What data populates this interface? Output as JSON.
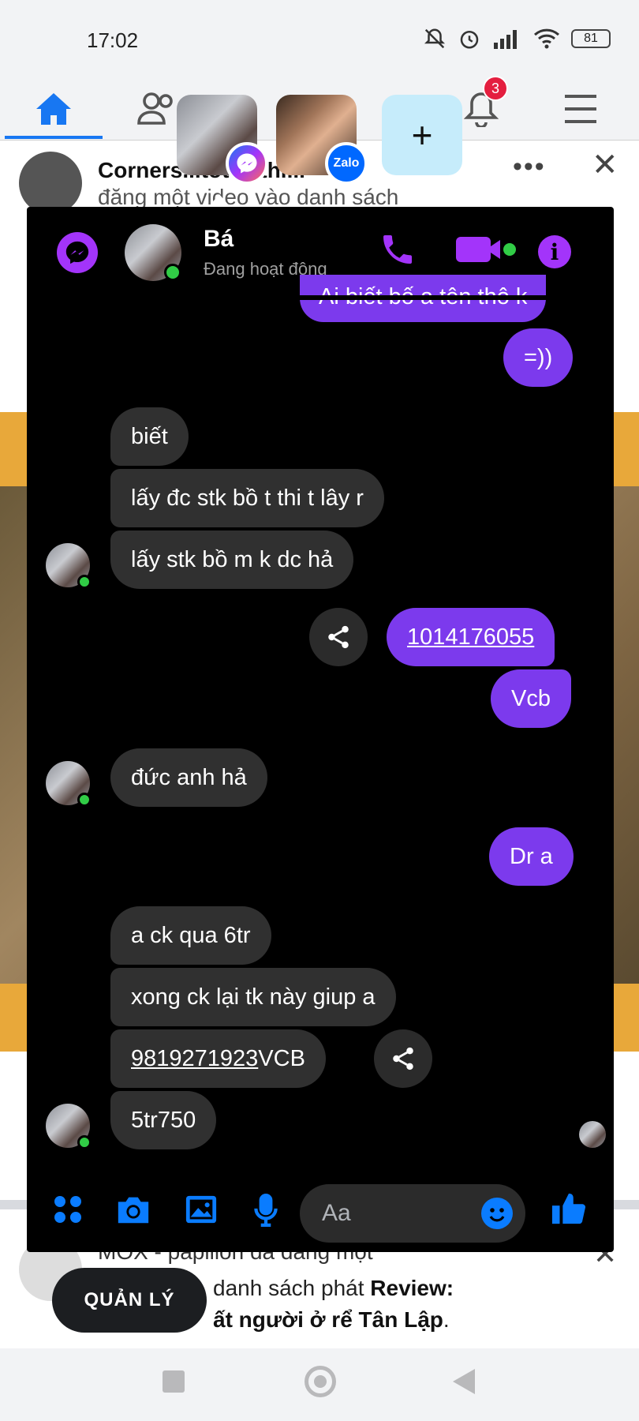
{
  "status_bar": {
    "time": "17:02",
    "battery": "81"
  },
  "fb_nav": {
    "notifications_count": "3"
  },
  "feed": {
    "post1": {
      "author": "Corners...tota...thi...",
      "subtitle": "đăng một video vào danh sách"
    },
    "post2": {
      "author": "MOX - papillon đã đăng một",
      "line1": "danh sách phát ",
      "line1_bold": "Review:",
      "line2_bold": "ất người ở rể Tân Lập",
      "line2_end": "."
    },
    "manage_button": "QUẢN LÝ"
  },
  "chat_heads": {
    "add_label": "+",
    "zalo_label": "Zalo"
  },
  "messenger": {
    "contact_name": "Bá",
    "contact_status": "Đang hoạt động",
    "messages": [
      {
        "side": "out",
        "text": "Ai biết bố a tên thô k"
      },
      {
        "side": "out",
        "text": "=))"
      },
      {
        "side": "in",
        "text": "biết"
      },
      {
        "side": "in",
        "text": "lấy đc stk bồ t thi t lây r"
      },
      {
        "side": "in",
        "text": "lấy stk bồ m k dc hả"
      },
      {
        "side": "out",
        "text": "1014176055"
      },
      {
        "side": "out",
        "text": "Vcb"
      },
      {
        "side": "in",
        "text": "đức anh hả"
      },
      {
        "side": "out",
        "text": "Dr a"
      },
      {
        "side": "in",
        "text": "a ck qua 6tr"
      },
      {
        "side": "in",
        "text": "xong ck lại tk này giup a"
      },
      {
        "side": "in",
        "text_link": "9819271923",
        "text_rest": " VCB"
      },
      {
        "side": "in",
        "text": "5tr750"
      }
    ],
    "composer_placeholder": "Aa"
  },
  "colors": {
    "accent": "#a334fa",
    "outgoing_bubble": "#7c3aed",
    "incoming_bubble": "#303030",
    "fb_blue": "#1877f2"
  }
}
